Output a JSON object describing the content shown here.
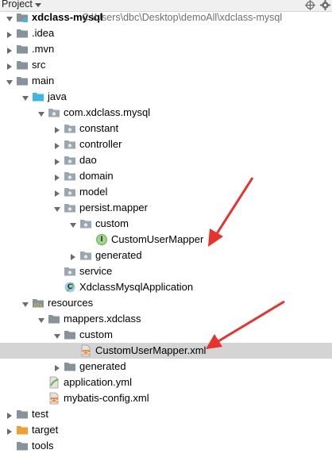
{
  "header": {
    "title": "Project",
    "target_icon": "crosshair-icon",
    "settings_icon": "gear-icon"
  },
  "project": {
    "name": "xdclass-mysql",
    "path": "C:\\Users\\dbc\\Desktop\\demoAll\\xdclass-mysql"
  },
  "tree": [
    {
      "label": "xdclass-mysql",
      "icon": "module-folder-icon",
      "expanded": true
    },
    {
      "label": ".idea",
      "icon": "folder-icon",
      "expanded": false
    },
    {
      "label": ".mvn",
      "icon": "folder-icon",
      "expanded": false
    },
    {
      "label": "src",
      "icon": "folder-icon",
      "expanded": false
    },
    {
      "label": "main",
      "icon": "folder-icon",
      "expanded": true
    },
    {
      "label": "java",
      "icon": "source-folder-icon",
      "expanded": true
    },
    {
      "label": "com.xdclass.mysql",
      "icon": "package-icon",
      "expanded": true
    },
    {
      "label": "constant",
      "icon": "package-icon",
      "expanded": false
    },
    {
      "label": "controller",
      "icon": "package-icon",
      "expanded": false
    },
    {
      "label": "dao",
      "icon": "package-icon",
      "expanded": false
    },
    {
      "label": "domain",
      "icon": "package-icon",
      "expanded": false
    },
    {
      "label": "model",
      "icon": "package-icon",
      "expanded": false
    },
    {
      "label": "persist.mapper",
      "icon": "package-icon",
      "expanded": true
    },
    {
      "label": "custom",
      "icon": "package-icon",
      "expanded": true
    },
    {
      "label": "CustomUserMapper",
      "icon": "interface-icon",
      "badge": "I"
    },
    {
      "label": "generated",
      "icon": "package-icon",
      "expanded": false
    },
    {
      "label": "service",
      "icon": "package-icon"
    },
    {
      "label": "XdclassMysqlApplication",
      "icon": "spring-class-icon",
      "badge": "C"
    },
    {
      "label": "resources",
      "icon": "resources-folder-icon",
      "expanded": true
    },
    {
      "label": "mappers.xdclass",
      "icon": "folder-icon",
      "expanded": true
    },
    {
      "label": "custom",
      "icon": "folder-icon",
      "expanded": true
    },
    {
      "label": "CustomUserMapper.xml",
      "icon": "xml-file-icon",
      "selected": true,
      "badge": "<>"
    },
    {
      "label": "generated",
      "icon": "folder-icon",
      "expanded": false
    },
    {
      "label": "application.yml",
      "icon": "yml-file-icon"
    },
    {
      "label": "mybatis-config.xml",
      "icon": "xml-file-icon",
      "badge": "<>"
    },
    {
      "label": "test",
      "icon": "folder-icon",
      "expanded": false
    },
    {
      "label": "target",
      "icon": "excluded-folder-icon",
      "expanded": false
    },
    {
      "label": "tools",
      "icon": "folder-icon"
    }
  ],
  "colors": {
    "folder": "#87939a",
    "package": "#9aa7b0",
    "source_folder": "#40b6e0",
    "resources": "#b0a070",
    "excluded": "#f0a030",
    "interface_badge": "#62b543",
    "selection": "#d4d4d4",
    "annotation_arrow": "#e8322c"
  }
}
